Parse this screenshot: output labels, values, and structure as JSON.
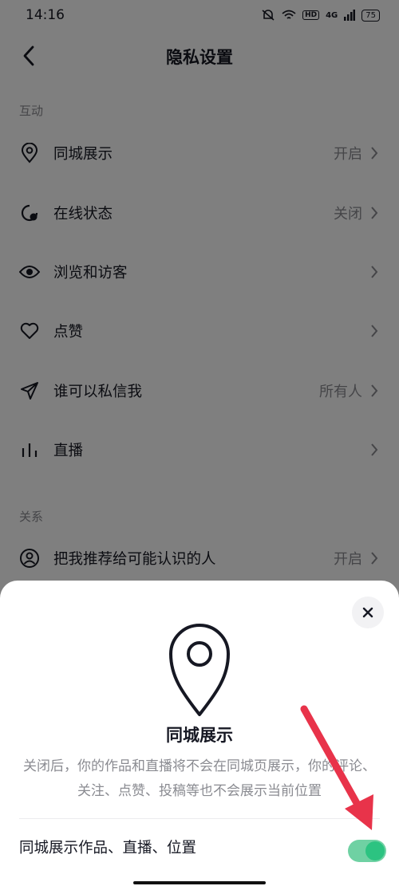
{
  "status_bar": {
    "time": "14:16",
    "hd": "HD",
    "network": "4G",
    "battery": "75"
  },
  "header": {
    "title": "隐私设置"
  },
  "sections": [
    {
      "label": "互动"
    },
    {
      "label": "关系"
    }
  ],
  "rows": [
    {
      "label": "同城展示",
      "value": "开启",
      "icon": "location-pin-icon"
    },
    {
      "label": "在线状态",
      "value": "关闭",
      "icon": "online-status-icon"
    },
    {
      "label": "浏览和访客",
      "value": "",
      "icon": "eye-icon"
    },
    {
      "label": "点赞",
      "value": "",
      "icon": "heart-icon"
    },
    {
      "label": "谁可以私信我",
      "value": "所有人",
      "icon": "paper-plane-icon"
    },
    {
      "label": "直播",
      "value": "",
      "icon": "bar-chart-icon"
    },
    {
      "label": "把我推荐给可能认识的人",
      "value": "开启",
      "icon": "user-circle-icon"
    }
  ],
  "sheet": {
    "title": "同城展示",
    "description": "关闭后，你的作品和直播将不会在同城页展示，你的评论、关注、点赞、投稿等也不会展示当前位置",
    "toggle_label": "同城展示作品、直播、位置",
    "toggle_on": true
  },
  "colors": {
    "toggle_on": "#2cc381",
    "arrow": "#e8334a",
    "overlay": "rgba(0,0,0,0.5)"
  }
}
